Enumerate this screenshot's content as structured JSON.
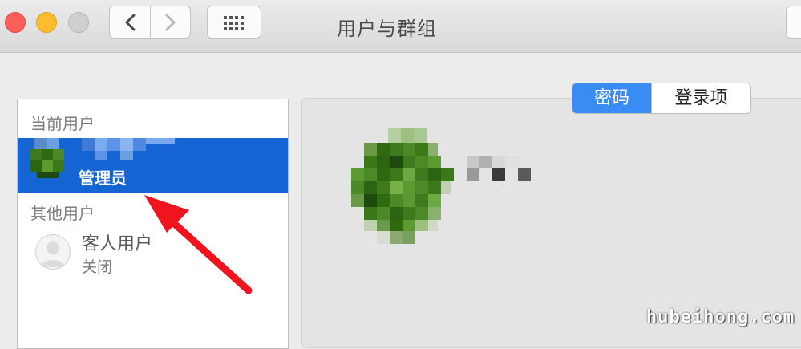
{
  "window": {
    "title": "用户与群组"
  },
  "sidebar": {
    "current_user_header": "当前用户",
    "other_users_header": "其他用户",
    "admin": {
      "role": "管理员",
      "name_redacted": true
    },
    "guest": {
      "name": "客人用户",
      "status": "关闭",
      "icon": "person-silhouette-icon"
    }
  },
  "tabs": {
    "password": "密码",
    "login_items": "登录项",
    "selected": "password"
  },
  "watermark": "hubeihong.com",
  "colors": {
    "selection": "#1464d4",
    "segment_selected": "#3a8cf5",
    "arrow": "#f0141e",
    "close": "#fc5f57",
    "minimize": "#fdbc2e"
  }
}
